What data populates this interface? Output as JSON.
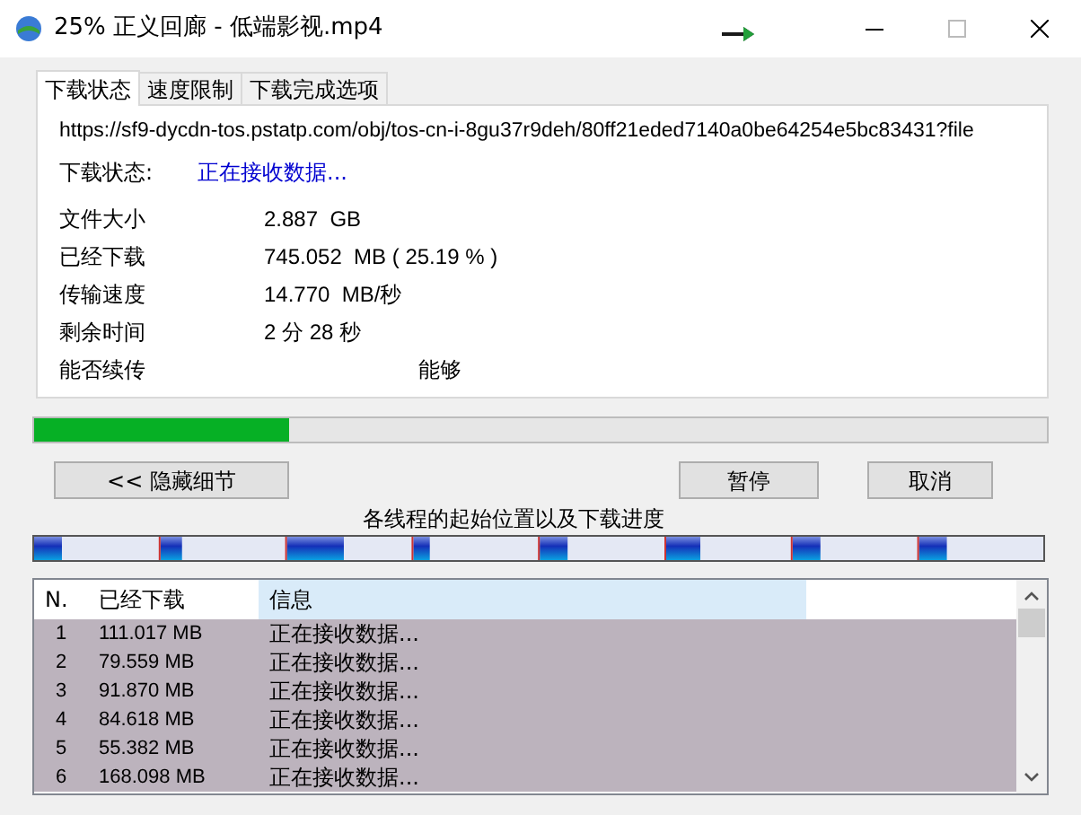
{
  "window": {
    "title": "25% 正义回廊 - 低端影视.mp4"
  },
  "tabs": [
    {
      "label": "下载状态",
      "selected": true
    },
    {
      "label": "速度限制",
      "selected": false
    },
    {
      "label": "下载完成选项",
      "selected": false
    }
  ],
  "url": "https://sf9-dycdn-tos.pstatp.com/obj/tos-cn-i-8gu37r9deh/80ff21eded7140a0be64254e5bc83431?file",
  "status": {
    "label": "下载状态:",
    "value": "正在接收数据..."
  },
  "details": [
    {
      "label": "文件大小",
      "value": "2.887  GB"
    },
    {
      "label": "已经下载",
      "value": "745.052  MB ( 25.19 % )"
    },
    {
      "label": "传输速度",
      "value": "14.770  MB/秒"
    },
    {
      "label": "剩余时间",
      "value": "2 分 28 秒"
    },
    {
      "label": "能否续传",
      "value": "能够"
    }
  ],
  "progress": {
    "level": 0.2519
  },
  "buttons": {
    "details": "<< 隐藏细节",
    "pause": "暂停",
    "cancel": "取消"
  },
  "threads_caption": "各线程的起始位置以及下载进度",
  "table": {
    "columns": [
      {
        "label": "N.",
        "selected": false
      },
      {
        "label": "已经下载",
        "selected": false
      },
      {
        "label": "信息",
        "selected": true
      }
    ],
    "rows": [
      {
        "cells": [
          "1",
          "111.017 MB",
          "正在接收数据..."
        ],
        "selected": true
      },
      {
        "cells": [
          "2",
          "79.559 MB",
          "正在接收数据..."
        ],
        "selected": true
      },
      {
        "cells": [
          "3",
          "91.870 MB",
          "正在接收数据..."
        ],
        "selected": true
      },
      {
        "cells": [
          "4",
          "84.618 MB",
          "正在接收数据..."
        ],
        "selected": true
      },
      {
        "cells": [
          "5",
          "55.382 MB",
          "正在接收数据..."
        ],
        "selected": true
      },
      {
        "cells": [
          "6",
          "168.098 MB",
          "正在接收数据..."
        ],
        "selected": true
      }
    ]
  }
}
